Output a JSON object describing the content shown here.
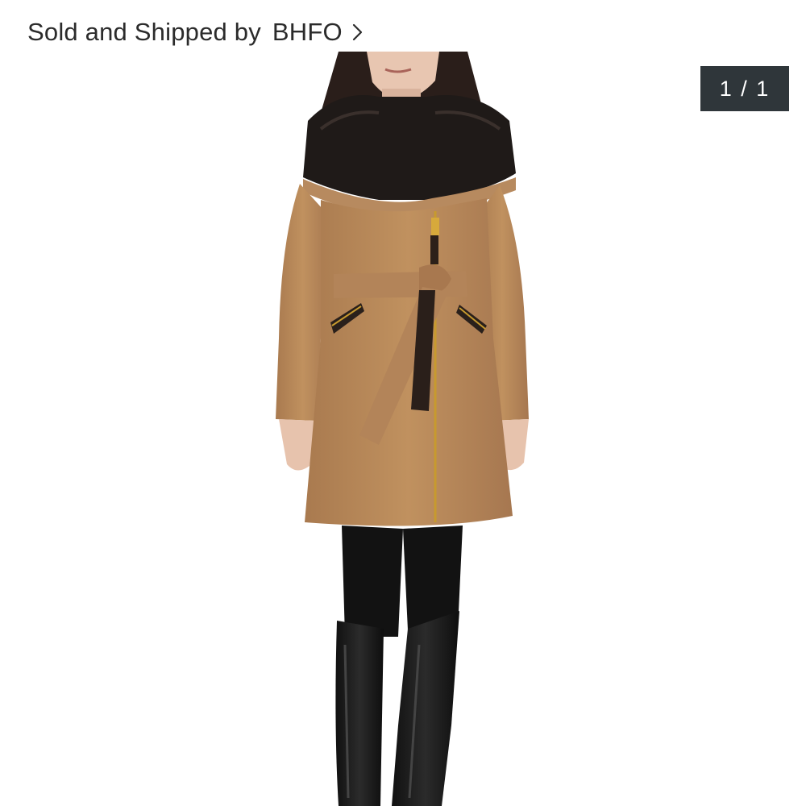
{
  "seller": {
    "prefix": "Sold and Shipped by",
    "name": "BHFO",
    "chevron_icon": "chevron-right-icon"
  },
  "gallery": {
    "counter": "1 / 1",
    "current": 1,
    "total": 1
  },
  "colors": {
    "text": "#2b2b2b",
    "counter_bg": "#2f363a",
    "counter_text": "#ffffff",
    "coat_camel": "#b98a5e",
    "fur_collar": "#1f1a18"
  }
}
